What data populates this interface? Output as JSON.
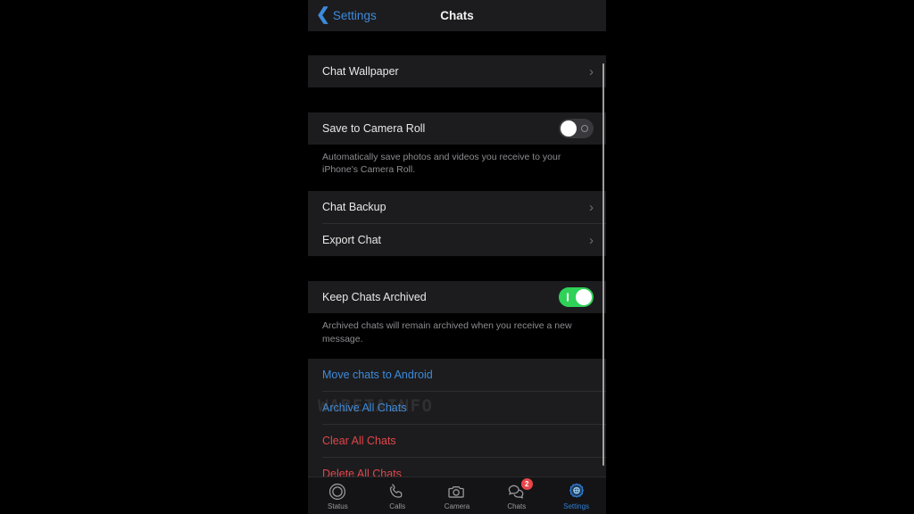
{
  "navbar": {
    "back_label": "Settings",
    "back_icon": "chevron-left-icon",
    "title": "Chats"
  },
  "sections": {
    "wallpaper": {
      "label": "Chat Wallpaper",
      "chevron": "›"
    },
    "camera_roll": {
      "label": "Save to Camera Roll",
      "toggle_state": "off",
      "footnote": "Automatically save photos and videos you receive to your iPhone's Camera Roll."
    },
    "backup": {
      "chat_backup_label": "Chat Backup",
      "export_chat_label": "Export Chat",
      "chevron": "›"
    },
    "archive": {
      "label": "Keep Chats Archived",
      "toggle_state": "on",
      "footnote": "Archived chats will remain archived when you receive a new message."
    },
    "actions": [
      {
        "label": "Move chats to Android",
        "style": "blue"
      },
      {
        "label": "Archive All Chats",
        "style": "blue"
      },
      {
        "label": "Clear All Chats",
        "style": "red"
      },
      {
        "label": "Delete All Chats",
        "style": "red"
      }
    ]
  },
  "watermark": "WABETAINFO",
  "tabbar": {
    "items": [
      {
        "label": "Status",
        "icon": "status-rings-icon",
        "active": false,
        "badge": ""
      },
      {
        "label": "Calls",
        "icon": "phone-icon",
        "active": false,
        "badge": ""
      },
      {
        "label": "Camera",
        "icon": "camera-icon",
        "active": false,
        "badge": ""
      },
      {
        "label": "Chats",
        "icon": "chat-bubbles-icon",
        "active": false,
        "badge": "2"
      },
      {
        "label": "Settings",
        "icon": "gear-icon",
        "active": true,
        "badge": ""
      }
    ]
  },
  "colors": {
    "accent_blue": "#3c8bdc",
    "destructive_red": "#e0464a",
    "toggle_on_green": "#2fd158",
    "badge_red": "#e8464a",
    "row_background": "#1c1c1e",
    "page_background": "#000000"
  }
}
